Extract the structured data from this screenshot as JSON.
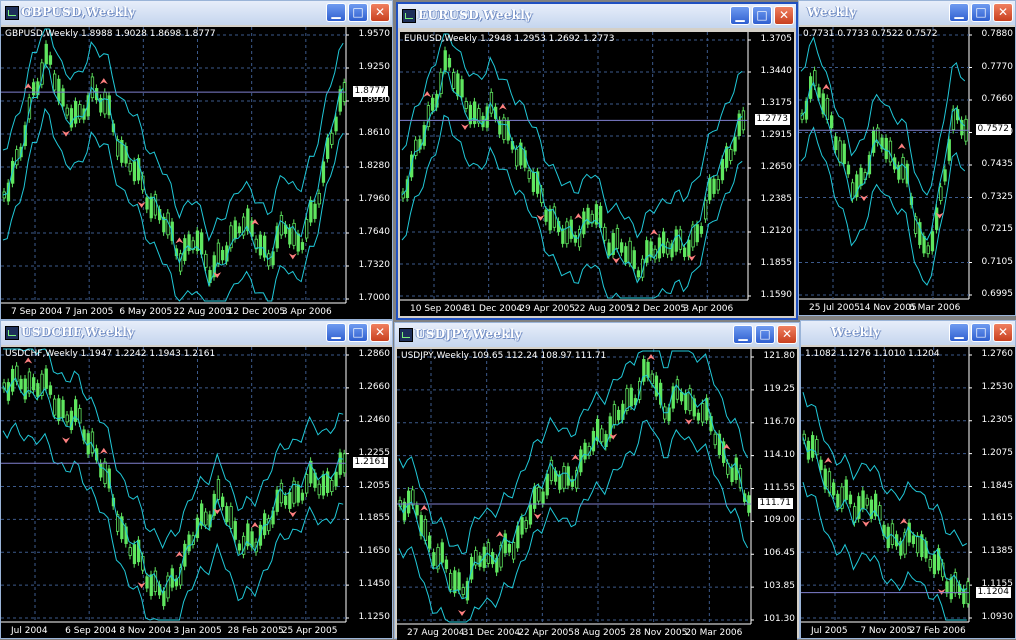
{
  "windows": [
    {
      "id": "gbpusd",
      "title": "GBPUSD,Weekly",
      "info": "GBPUSD,Weekly  1.8988 1.9028 1.8698 1.8777",
      "price_labels": [
        "1.9570",
        "1.9250",
        "1.8930",
        "1.8610",
        "1.8280",
        "1.7960",
        "1.7640",
        "1.7320",
        "1.7000"
      ],
      "current_price": "1.8777",
      "date_labels": [
        "7 Sep 2004",
        "7 Jan 2005",
        "6 May 2005",
        "22 Aug 2005",
        "12 Dec 2005",
        "3 Apr 2006"
      ]
    },
    {
      "id": "eurusd",
      "title": "EURUSD,Weekly",
      "info": "EURUSD,Weekly  1.2948 1.2953 1.2692 1.2773",
      "price_labels": [
        "1.3705",
        "1.3440",
        "1.3175",
        "1.2915",
        "1.2650",
        "1.2385",
        "1.2120",
        "1.1855",
        "1.1590"
      ],
      "current_price": "1.2773",
      "date_labels": [
        "10 Sep 2004",
        "31 Dec 2004",
        "29 Apr 2005",
        "22 Aug 2005",
        "12 Dec 2005",
        "3 Apr 2006"
      ]
    },
    {
      "id": "third",
      "title": "Weekly",
      "info": "0.7731 0.7733 0.7522 0.7572",
      "price_labels": [
        "0.7880",
        "0.7770",
        "0.7660",
        "0.7550",
        "0.7435",
        "0.7325",
        "0.7215",
        "0.7105",
        "0.6995"
      ],
      "current_price": "0.7572",
      "date_labels": [
        "25 Jul 2005",
        "14 Nov 2005",
        "6 Mar 2006"
      ]
    },
    {
      "id": "usdchf",
      "title": "USDCHF,Weekly",
      "info": "USDCHF,Weekly  1.1947 1.2242 1.1943 1.2161",
      "price_labels": [
        "1.2860",
        "1.2660",
        "1.2460",
        "1.2255",
        "1.2055",
        "1.1855",
        "1.1650",
        "1.1450",
        "1.1250"
      ],
      "current_price": "1.2161",
      "date_labels": [
        "Jul 2004",
        "6 Sep 2004",
        "8 Nov 2004",
        "3 Jan 2005",
        "28 Feb 2005",
        "25 Apr 2005"
      ]
    },
    {
      "id": "usdjpy",
      "title": "USDJPY,Weekly",
      "info": "USDJPY,Weekly  109.65 112.24 108.97 111.71",
      "price_labels": [
        "121.80",
        "119.25",
        "116.70",
        "114.10",
        "111.55",
        "109.00",
        "106.45",
        "103.85",
        "101.30"
      ],
      "current_price": "111.71",
      "date_labels": [
        "27 Aug 2004",
        "31 Dec 2004",
        "22 Apr 2005",
        "8 Aug 2005",
        "28 Nov 2005",
        "20 Mar 2006"
      ]
    },
    {
      "id": "sixth",
      "title": "Weekly",
      "info": "1.1082 1.1276 1.1010 1.1204",
      "price_labels": [
        "1.2760",
        "1.2530",
        "1.2305",
        "1.2075",
        "1.1845",
        "1.1615",
        "1.1385",
        "1.1155",
        "1.0930"
      ],
      "current_price": "1.1204",
      "date_labels": [
        "Jul 2005",
        "7 Nov 2005",
        "27 Feb 2006"
      ]
    }
  ],
  "icons": {
    "minimize": "minimize-icon",
    "maximize": "maximize-icon",
    "close": "close-icon"
  },
  "colors": {
    "grid": "#3c5a8c",
    "candles": "#5fe65f",
    "bands": "#20c8d8",
    "arrows": "#ff8080",
    "current_line": "#8080d0"
  }
}
